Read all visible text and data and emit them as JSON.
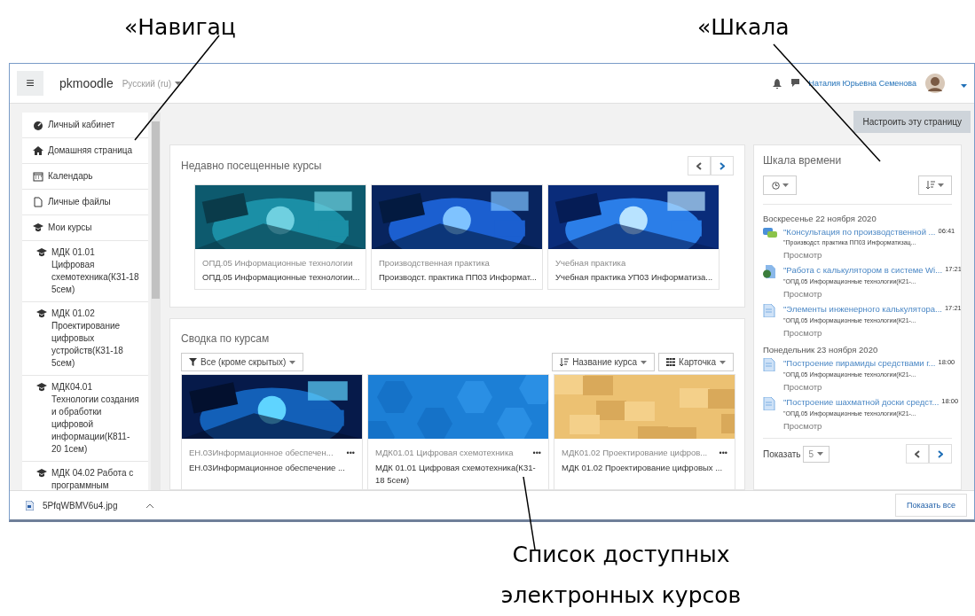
{
  "annotations": {
    "top_left": "«Навигац",
    "top_right": "«Шкала",
    "bottom": "Список доступных электронных курсов"
  },
  "navbar": {
    "menu": "≡",
    "site": "pkmoodle",
    "language": "Русский (ru)",
    "user": "Наталия Юрьевна Семенова"
  },
  "sidebar": {
    "items": [
      {
        "kind": "dashboard",
        "label": "Личный кабинет"
      },
      {
        "kind": "home",
        "label": "Домашняя страница"
      },
      {
        "kind": "calendar",
        "label": "Календарь"
      },
      {
        "kind": "file",
        "label": "Личные файлы"
      },
      {
        "kind": "courses",
        "label": "Мои курсы"
      },
      {
        "kind": "course",
        "label": "МДК 01.01 Цифровая схемотехника(К31-18 5сем)"
      },
      {
        "kind": "course",
        "label": "МДК 01.02 Проектирование цифровых устройств(К31-18 5сем)"
      },
      {
        "kind": "course",
        "label": "МДК04.01 Технологии создания и обработки цифровой информации(К811-20 1сем)"
      },
      {
        "kind": "course",
        "label": "МДК 04.02 Работа с программным"
      }
    ]
  },
  "customize_button": "Настроить эту страницу",
  "recent": {
    "title": "Недавно посещенные курсы",
    "courses": [
      {
        "category": "ОПД.05 Информационные технологии",
        "name": "ОПД.05 Информационные технологии..."
      },
      {
        "category": "Производственная практика",
        "name": "Производст. практика ПП03 Информат..."
      },
      {
        "category": "Учебная практика",
        "name": "Учебная практика УП03 Информатиза..."
      }
    ]
  },
  "overview": {
    "title": "Сводка по курсам",
    "filter": "Все (кроме скрытых)",
    "sort": "Название курса",
    "view": "Карточка",
    "courses": [
      {
        "category": "ЕН.03Информационное обеспечен...",
        "name": "ЕН.03Информационное обеспечение ...",
        "menu": "•••"
      },
      {
        "category": "МДК01.01 Цифровая схемотехника",
        "name": "МДК 01.01 Цифровая схемотехника(К31-18 5сем)",
        "menu": "•••"
      },
      {
        "category": "МДК01.02 Проектирование цифров...",
        "name": "МДК 01.02 Проектирование цифровых ...",
        "menu": "•••"
      }
    ]
  },
  "timeline": {
    "title": "Шкала времени",
    "groups": [
      {
        "date": "Воскресенье 22 ноября 2020",
        "items": [
          {
            "kind": "chat",
            "title": "\"Консультация по производственной ...",
            "time": "06:41",
            "course": "\"Производст. практика ПП03 Информатизац...",
            "action": "Просмотр"
          },
          {
            "kind": "globe",
            "title": "\"Работа с калькулятором в системе Wi...",
            "time": "17:21",
            "course": "\"ОПД.05 Информационные технологии(К21-...",
            "action": "Просмотр"
          },
          {
            "kind": "doc",
            "title": "\"Элементы инженерного калькулятора...",
            "time": "17:21",
            "course": "\"ОПД.05 Информационные технологии(К21-...",
            "action": "Просмотр"
          }
        ]
      },
      {
        "date": "Понедельник 23 ноября 2020",
        "items": [
          {
            "kind": "doc",
            "title": "\"Построение пирамиды средствами г...",
            "time": "18:00",
            "course": "\"ОПД.05 Информационные технологии(К21-...",
            "action": "Просмотр"
          },
          {
            "kind": "doc",
            "title": "\"Построение шахматной доски средст...",
            "time": "18:00",
            "course": "\"ОПД.05 Информационные технологии(К21-...",
            "action": "Просмотр"
          }
        ]
      }
    ],
    "show_label": "Показать",
    "show_value": "5"
  },
  "download_bar": {
    "file": "5PfqWBMV6u4.jpg",
    "show_all": "Показать все"
  }
}
